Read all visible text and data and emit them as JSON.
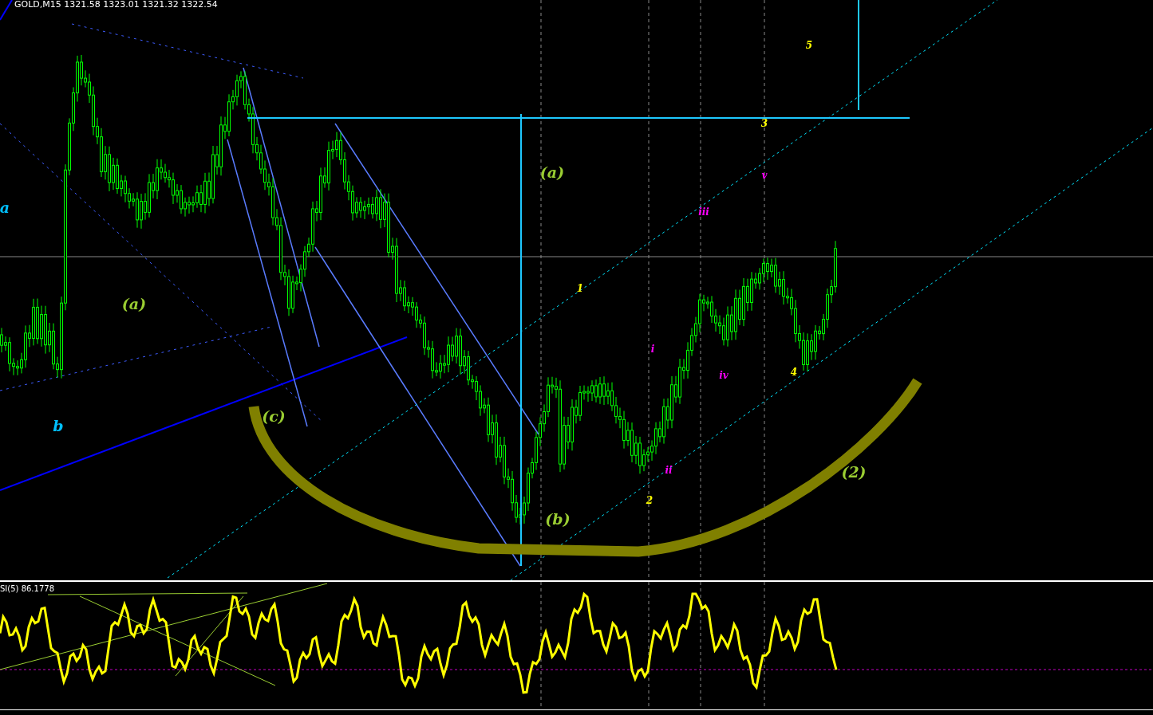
{
  "chart": {
    "header": "GOLD,M15 1321.58 1323.01 1321.32 1322.54",
    "labels": [
      {
        "text": "a",
        "kind": "major",
        "color": "#00bfff"
      },
      {
        "text": "(a)",
        "kind": "major",
        "color": "#9acd32"
      },
      {
        "text": "b",
        "kind": "major",
        "color": "#00bfff"
      },
      {
        "text": "(c)",
        "kind": "major",
        "color": "#9acd32"
      },
      {
        "text": "(a)",
        "kind": "major",
        "color": "#9acd32"
      },
      {
        "text": "(b)",
        "kind": "major",
        "color": "#9acd32"
      },
      {
        "text": "(2)",
        "kind": "major",
        "color": "#9acd32"
      },
      {
        "text": "1",
        "kind": "minor",
        "color": "#ffff00"
      },
      {
        "text": "2",
        "kind": "minor",
        "color": "#ffff00"
      },
      {
        "text": "3",
        "kind": "minor",
        "color": "#ffff00"
      },
      {
        "text": "4",
        "kind": "minor",
        "color": "#ffff00"
      },
      {
        "text": "5",
        "kind": "minor",
        "color": "#ffff00"
      },
      {
        "text": "i",
        "kind": "minor",
        "color": "#ff00ff"
      },
      {
        "text": "ii",
        "kind": "minor",
        "color": "#ff00ff"
      },
      {
        "text": "iii",
        "kind": "minor",
        "color": "#ff00ff"
      },
      {
        "text": "iv",
        "kind": "minor",
        "color": "#ff00ff"
      },
      {
        "text": "v",
        "kind": "minor",
        "color": "#ff00ff"
      }
    ]
  },
  "indicator": {
    "label": "SI(5) 86.1778"
  }
}
